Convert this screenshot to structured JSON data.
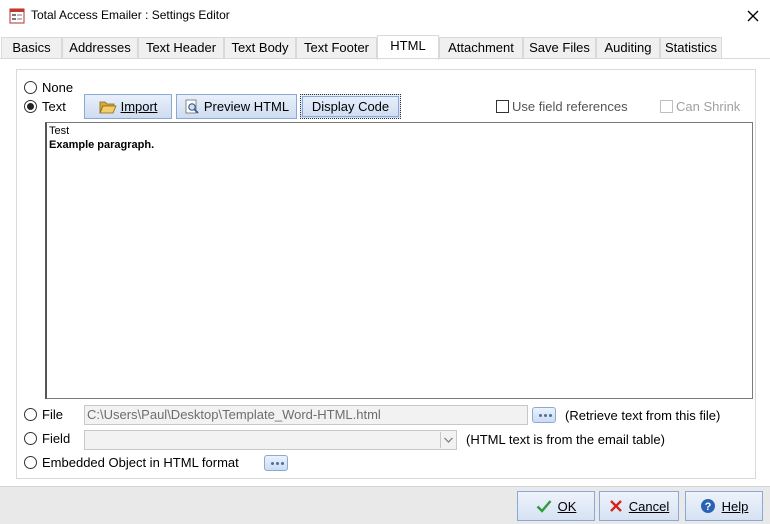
{
  "window": {
    "title": "Total Access Emailer : Settings Editor"
  },
  "tabs": [
    {
      "label": "Basics",
      "active": false
    },
    {
      "label": "Addresses",
      "active": false
    },
    {
      "label": "Text Header",
      "active": false
    },
    {
      "label": "Text Body",
      "active": false
    },
    {
      "label": "Text Footer",
      "active": false
    },
    {
      "label": "HTML",
      "active": true
    },
    {
      "label": "Attachment",
      "active": false
    },
    {
      "label": "Save Files",
      "active": false
    },
    {
      "label": "Auditing",
      "active": false
    },
    {
      "label": "Statistics",
      "active": false
    }
  ],
  "options": {
    "none_label": "None",
    "text_label": "Text",
    "file_label": "File",
    "field_label": "Field",
    "embedded_label": "Embedded Object in HTML format",
    "selected": "Text"
  },
  "toolbar": {
    "import_label": "Import",
    "preview_label": "Preview HTML",
    "display_code_label": "Display Code",
    "use_field_refs_label": "Use field references",
    "can_shrink_label": "Can Shrink"
  },
  "editor": {
    "line1": "Test",
    "line2": "Example paragraph."
  },
  "file": {
    "path": "C:\\Users\\Paul\\Desktop\\Template_Word-HTML.html",
    "hint": "(Retrieve text from this file)"
  },
  "field": {
    "value": "",
    "hint": "(HTML text is from the email table)"
  },
  "footer": {
    "ok_label": "OK",
    "cancel_label": "Cancel",
    "help_label": "Help"
  },
  "colors": {
    "button_border": "#8aa9d4",
    "ok_check": "#2e9b3a",
    "cancel_x": "#d0271d",
    "help_icon": "#2a63b6"
  }
}
